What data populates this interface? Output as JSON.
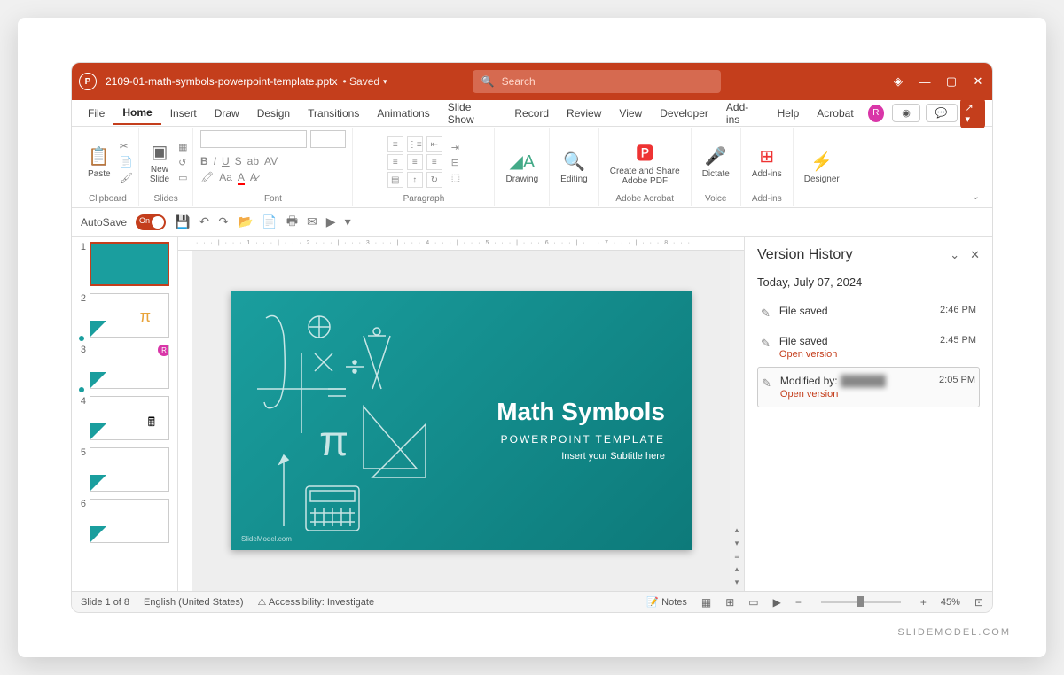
{
  "titlebar": {
    "filename": "2109-01-math-symbols-powerpoint-template.pptx",
    "status": "Saved",
    "search_placeholder": "Search"
  },
  "menu": {
    "items": [
      "File",
      "Home",
      "Insert",
      "Draw",
      "Design",
      "Transitions",
      "Animations",
      "Slide Show",
      "Record",
      "Review",
      "View",
      "Developer",
      "Add-ins",
      "Help",
      "Acrobat"
    ],
    "active": "Home",
    "user_initial": "R"
  },
  "ribbon": {
    "paste": "Paste",
    "clipboard": "Clipboard",
    "newslide": "New\nSlide",
    "slides": "Slides",
    "font": "Font",
    "paragraph": "Paragraph",
    "drawing": "Drawing",
    "editing": "Editing",
    "acrobat_btn": "Create and Share\nAdobe PDF",
    "acrobat": "Adobe Acrobat",
    "dictate": "Dictate",
    "voice": "Voice",
    "addins": "Add-ins",
    "addins_grp": "Add-ins",
    "designer": "Designer"
  },
  "qat": {
    "autosave": "AutoSave",
    "on": "On"
  },
  "thumbs": [
    {
      "n": "1"
    },
    {
      "n": "2"
    },
    {
      "n": "3"
    },
    {
      "n": "4"
    },
    {
      "n": "5"
    },
    {
      "n": "6"
    }
  ],
  "slide": {
    "title": "Math Symbols",
    "subtitle": "POWERPOINT TEMPLATE",
    "subtitle2": "Insert your Subtitle here",
    "watermark": "SlideModel.com"
  },
  "panel": {
    "title": "Version History",
    "date": "Today, July 07, 2024",
    "entries": [
      {
        "text": "File saved",
        "time": "2:46 PM",
        "link": ""
      },
      {
        "text": "File saved",
        "time": "2:45 PM",
        "link": "Open version"
      },
      {
        "text": "Modified by:",
        "time": "2:05 PM",
        "link": "Open version",
        "blurred": true
      }
    ]
  },
  "status": {
    "slide": "Slide 1 of 8",
    "lang": "English (United States)",
    "access": "Accessibility: Investigate",
    "notes": "Notes",
    "zoom": "45%"
  },
  "brand": "SLIDEMODEL.COM",
  "ruler": "· · · | · · · 1 · · · | · · · 2 · · · | · · · 3 · · · | · · · 4 · · · | · · · 5 · · · | · · · 6 · · · | · · · 7 · · · | · · · 8 · · ·"
}
